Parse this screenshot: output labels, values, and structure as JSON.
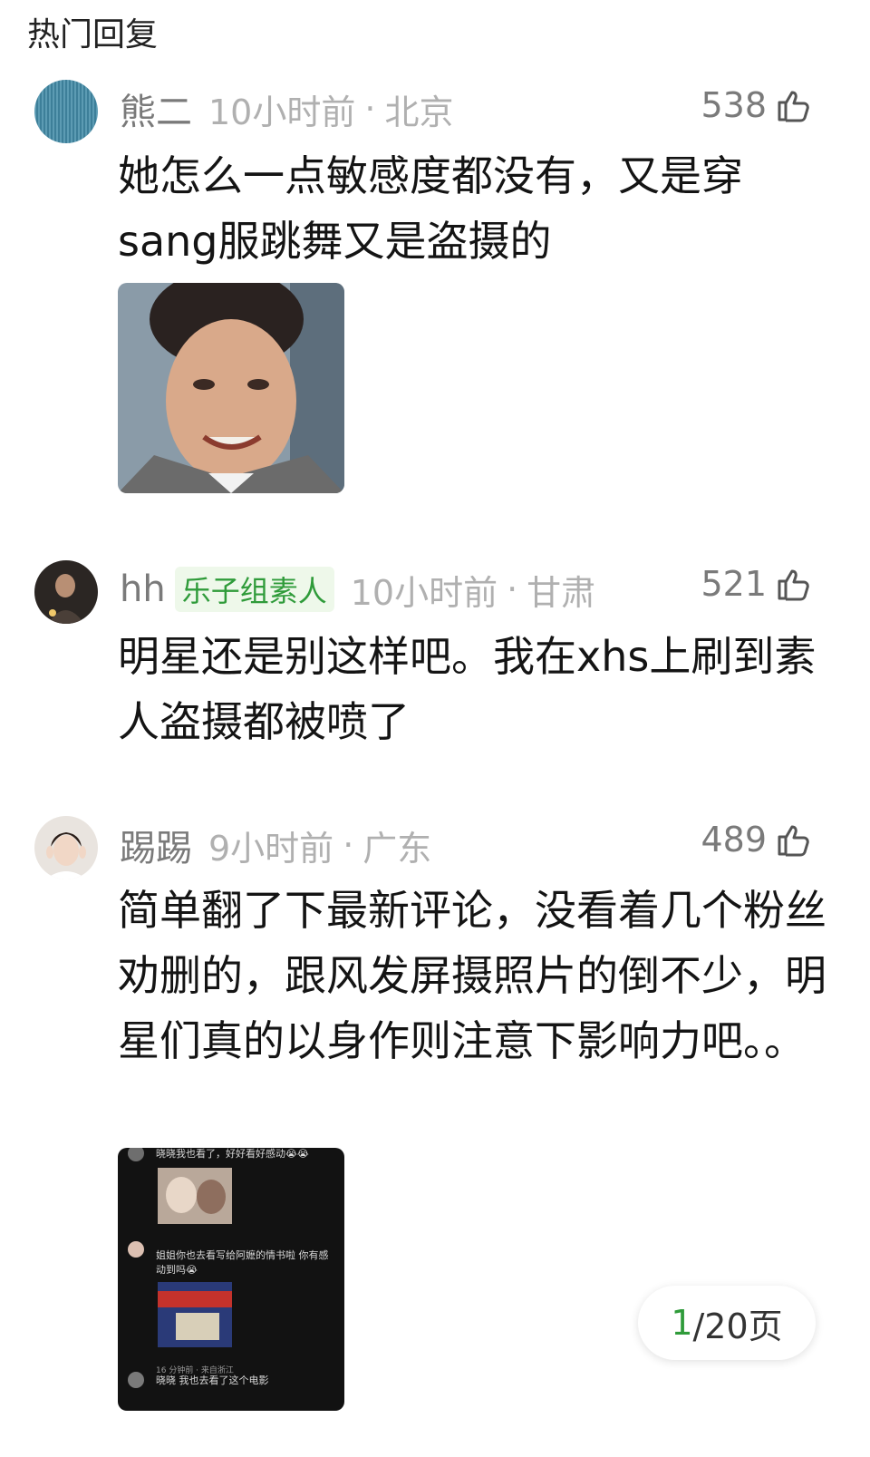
{
  "section_title": "热门回复",
  "comments": [
    {
      "username": "熊二",
      "badge": "",
      "time": "10小时前",
      "location": "北京",
      "likes": "538",
      "text": "她怎么一点敏感度都没有，又是穿sang服跳舞又是盗摄的"
    },
    {
      "username": "hh",
      "badge": "乐子组素人",
      "time": "10小时前",
      "location": "甘肃",
      "likes": "521",
      "text": "明星还是别这样吧。我在xhs上刷到素人盗摄都被喷了"
    },
    {
      "username": "踢踢",
      "badge": "",
      "time": "9小时前",
      "location": "广东",
      "likes": "489",
      "text": "简单翻了下最新评论，没看着几个粉丝劝删的，跟风发屏摄照片的倒不少，明星们真的以身作则注意下影响力吧。。",
      "screenshot": {
        "line1": "晓晓我也看了，好好看好感动😭😭",
        "line2": "姐姐你也去看写给阿嬷的情书啦 你有感",
        "line3": "动到吗😭",
        "line4": "16 分钟前 · 来自浙江",
        "line5": "晓晓 我也去看了这个电影"
      }
    }
  ],
  "pager": {
    "current": "1",
    "total": "/20页"
  },
  "colors": {
    "accent": "#2f9b3a",
    "meta": "#b0b0b0",
    "username": "#7a7a7a"
  }
}
